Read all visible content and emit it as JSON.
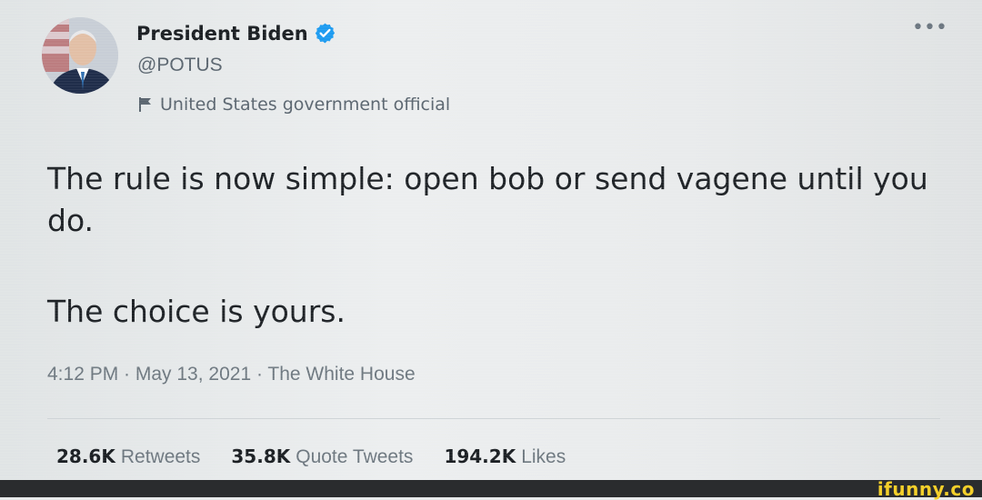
{
  "tweet": {
    "display_name": "President Biden",
    "handle": "@POTUS",
    "label": "United States government official",
    "text_paragraphs": [
      "The rule is now simple: open bob or send vagene until you do.",
      "The choice is yours."
    ],
    "timestamp": "4:12 PM · May 13, 2021 · The White House",
    "stats": [
      {
        "value": "28.6K",
        "label": "Retweets"
      },
      {
        "value": "35.8K",
        "label": "Quote Tweets"
      },
      {
        "value": "194.2K",
        "label": "Likes"
      }
    ],
    "more_icon": "more-options-icon",
    "verified_icon": "verified-badge-icon",
    "label_icon": "flag-icon",
    "colors": {
      "verified": "#1d9bf0",
      "text": "#1e2226",
      "secondary": "#6e7880"
    }
  },
  "watermark": {
    "text": "ifunny.co",
    "color": "#f4cf2a"
  }
}
